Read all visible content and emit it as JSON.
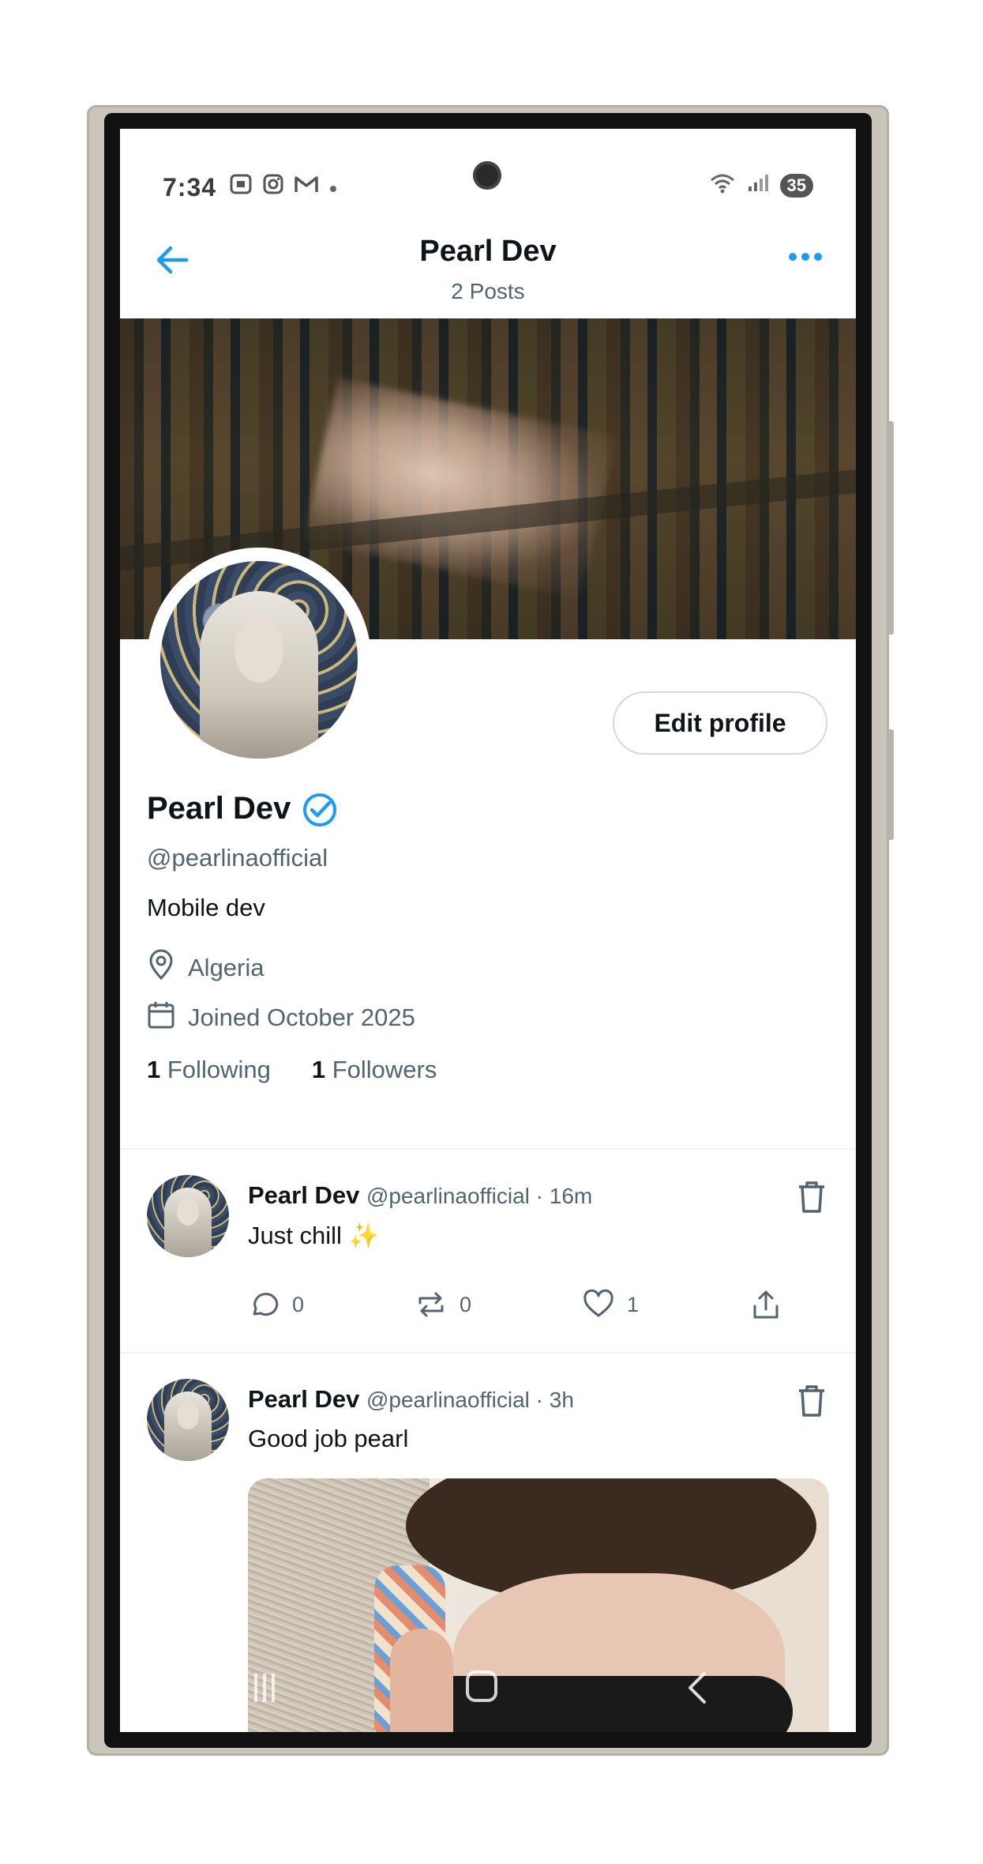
{
  "status_bar": {
    "time": "7:34",
    "icons": [
      "screenshot-icon",
      "instagram-icon",
      "gmail-icon",
      "dot-icon"
    ],
    "battery": "35"
  },
  "header": {
    "title": "Pearl Dev",
    "subtitle": "2 Posts"
  },
  "profile": {
    "name": "Pearl Dev",
    "handle": "@pearlinaofficial",
    "bio": "Mobile dev",
    "location": "Algeria",
    "joined": "Joined October 2025",
    "following_count": "1",
    "following_label": "Following",
    "followers_count": "1",
    "followers_label": "Followers",
    "edit_button": "Edit profile",
    "verified": true
  },
  "posts": [
    {
      "author": "Pearl Dev",
      "meta": "@pearlinaofficial · 16m",
      "text": "Just chill ✨",
      "replies": "0",
      "reposts": "0",
      "likes": "1"
    },
    {
      "author": "Pearl Dev",
      "meta": "@pearlinaofficial · 3h",
      "text": "Good job pearl"
    }
  ],
  "colors": {
    "accent": "#1d9bf0",
    "text_primary": "#0f1419",
    "text_secondary": "#536471",
    "divider": "#eff3f4"
  }
}
